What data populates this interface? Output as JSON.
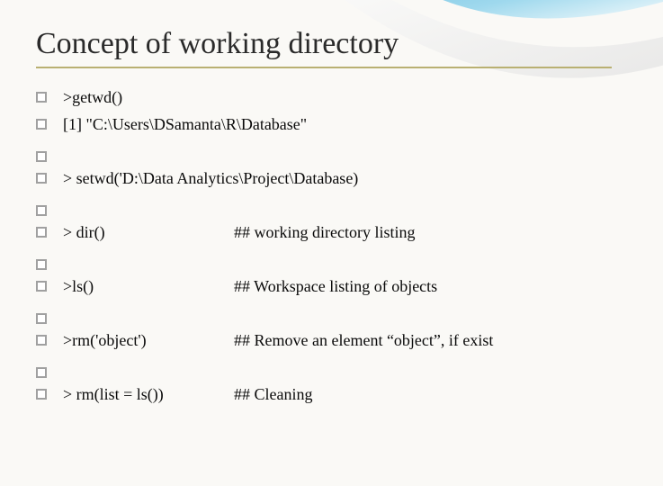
{
  "title": "Concept of working directory",
  "lines": {
    "l1": ">getwd()",
    "l2": "[1] \"C:\\Users\\DSamanta\\R\\Database\"",
    "l3": "> setwd('D:\\Data Analytics\\Project\\Database)",
    "l4_cmd": "> dir()",
    "l4_desc": "## working directory listing",
    "l5_cmd": ">ls()",
    "l5_desc": "## Workspace listing of objects",
    "l6_cmd": ">rm('object')",
    "l6_desc": "## Remove an element “object”, if exist",
    "l7_cmd": "> rm(list = ls())",
    "l7_desc": "## Cleaning"
  }
}
